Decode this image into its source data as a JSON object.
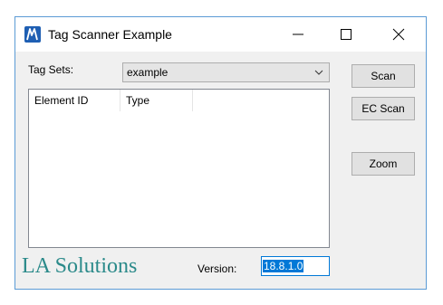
{
  "window": {
    "title": "Tag Scanner Example",
    "icon": "microstation-app-icon"
  },
  "titlebar_buttons": {
    "minimize": "minimize-icon",
    "maximize": "maximize-icon",
    "close": "close-icon"
  },
  "tagsets": {
    "label": "Tag Sets:",
    "selected": "example"
  },
  "list": {
    "columns": [
      "Element ID",
      "Type"
    ],
    "rows": []
  },
  "buttons": {
    "scan": "Scan",
    "ec_scan": "EC Scan",
    "zoom": "Zoom"
  },
  "brand": "LA Solutions",
  "version": {
    "label": "Version:",
    "value": "18.8.1.0"
  },
  "colors": {
    "brand": "#2b8a8a",
    "accent": "#0078d7",
    "window_border": "#5b9bd5"
  }
}
